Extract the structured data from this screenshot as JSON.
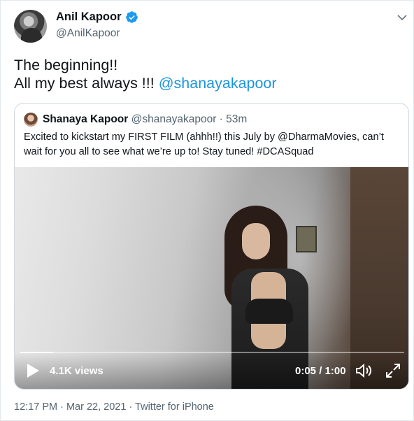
{
  "tweet": {
    "author": {
      "name": "Anil Kapoor",
      "handle": "@AnilKapoor",
      "verified": true
    },
    "text_line1": "The beginning!!",
    "text_line2_prefix": "All my best always !!! ",
    "text_mention": "@shanayakapoor",
    "footer": {
      "time": "12:17 PM",
      "separator1": " · ",
      "date": "Mar 22, 2021",
      "separator2": " · ",
      "source": "Twitter for iPhone"
    }
  },
  "quoted_tweet": {
    "author_name": "Shanaya Kapoor",
    "author_handle": "@shanayakapoor",
    "separator": " · ",
    "age": "53m",
    "text": "Excited to kickstart my FIRST FILM (ahhh!!) this July by @DharmaMovies, can’t wait for you all to see what we’re up to! Stay tuned! #DCASquad"
  },
  "video": {
    "views": "4.1K views",
    "elapsed": "0:05",
    "time_separator": " / ",
    "duration": "1:00",
    "progress_fraction": 0.085
  },
  "colors": {
    "accent": "#1b95e0",
    "verified": "#1d9bf0",
    "secondary_text": "#536471",
    "border": "#cfd9de"
  },
  "icons": {
    "verified": "verified-badge-icon",
    "more": "chevron-down-icon",
    "play": "play-icon",
    "volume": "volume-icon",
    "expand": "expand-icon"
  }
}
